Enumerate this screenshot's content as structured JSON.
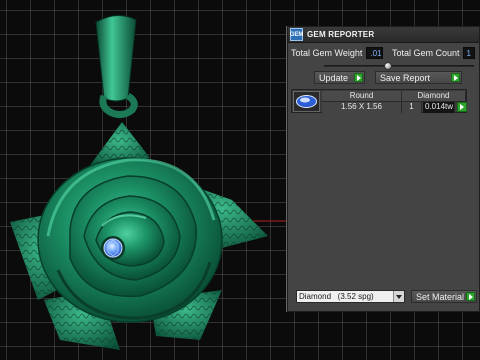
{
  "panel": {
    "title": "GEM REPORTER",
    "logo_text": "GEM",
    "total_weight_label": "Total Gem Weight",
    "total_weight_value": ".01",
    "total_count_label": "Total Gem Count",
    "total_count_value": "1",
    "update_label": "Update",
    "save_report_label": "Save Report",
    "table": {
      "headers": [
        "Round",
        "Diamond"
      ],
      "row": {
        "size": "1.56 X 1.56",
        "count": "1",
        "weight": "0.014tw"
      }
    },
    "material_select_value": "Diamond   (3.52 spg)",
    "set_material_label": "Set Material"
  },
  "colors": {
    "panel_bg": "#444444",
    "accent_go": "#2fa52f",
    "model_green": "#1f8a5c",
    "gem_blue": "#5aa0ff"
  },
  "icons": [
    "gem-reporter-logo-icon",
    "round-gem-icon",
    "play-arrow-icon",
    "dropdown-arrow-icon"
  ]
}
